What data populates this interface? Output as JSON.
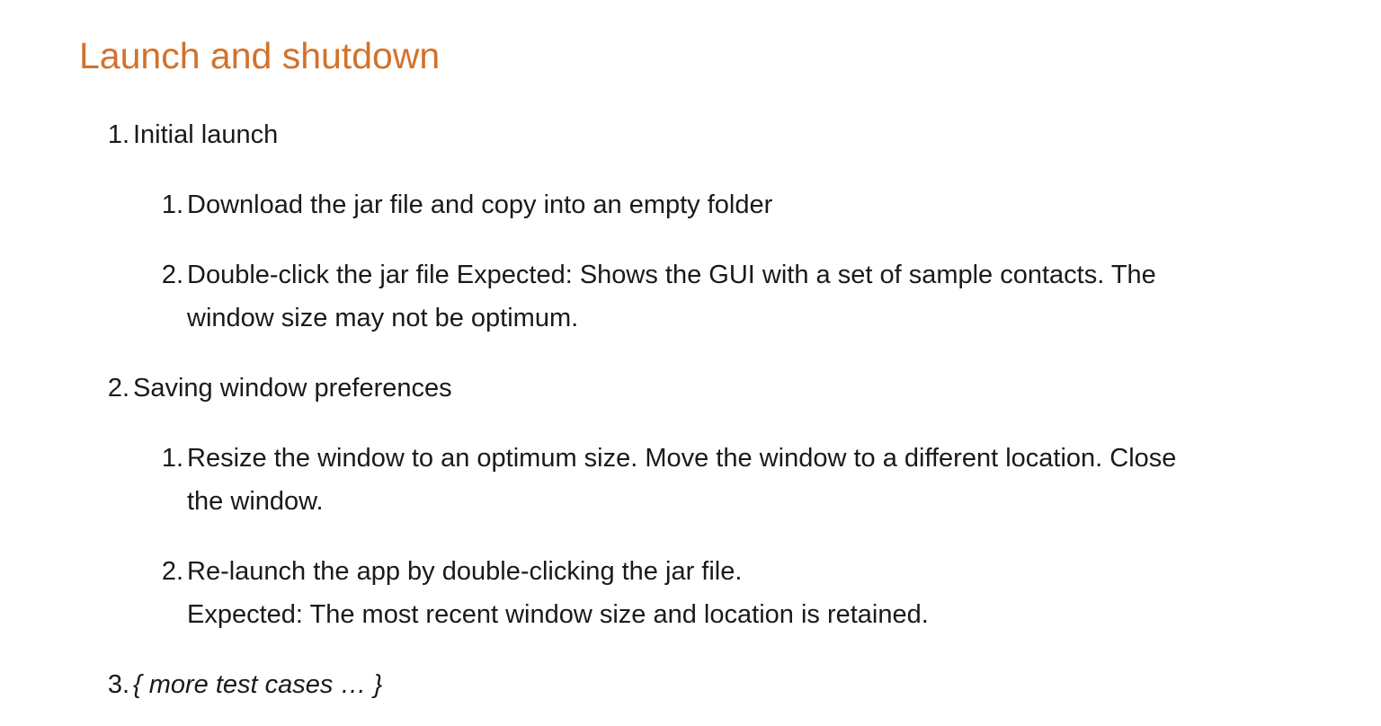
{
  "title": "Launch and shutdown",
  "items": [
    {
      "number": "1.",
      "label": "Initial launch",
      "steps": [
        {
          "number": "1.",
          "lines": [
            "Download the jar file and copy into an empty folder"
          ]
        },
        {
          "number": "2.",
          "lines": [
            "Double-click the jar file Expected: Shows the GUI with a set of sample contacts. The",
            "window size may not be optimum."
          ]
        }
      ]
    },
    {
      "number": "2.",
      "label": "Saving window preferences",
      "steps": [
        {
          "number": "1.",
          "lines": [
            "Resize the window to an optimum size. Move the window to a different location. Close",
            "the window."
          ]
        },
        {
          "number": "2.",
          "lines": [
            "Re-launch the app by double-clicking the jar file.",
            "Expected: The most recent window size and location is retained."
          ]
        }
      ]
    },
    {
      "number": "3.",
      "label": "{ more test cases … }"
    }
  ],
  "colors": {
    "heading": "#d2722b",
    "text": "#1a1a1a"
  }
}
